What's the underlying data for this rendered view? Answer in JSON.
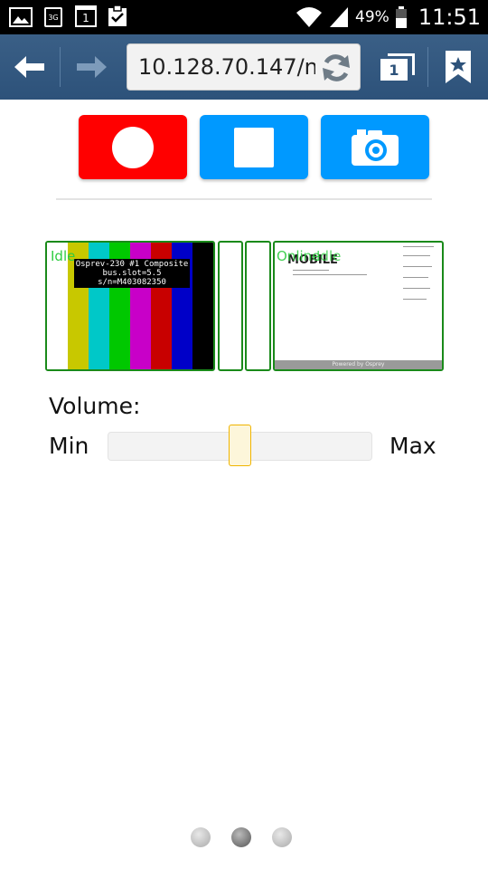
{
  "status_bar": {
    "battery_text": "49%",
    "time": "11:51",
    "icons": [
      "gallery-icon",
      "3g-icon",
      "calendar-icon",
      "clipboard-check-icon",
      "wifi-icon",
      "signal-icon",
      "battery-icon"
    ],
    "calendar_day": "1",
    "net_badge": "3G"
  },
  "browser": {
    "url": "10.128.70.147/n",
    "tab_count": "1",
    "icons": [
      "back-arrow-icon",
      "forward-arrow-icon",
      "reload-icon",
      "tabs-icon",
      "bookmark-icon"
    ]
  },
  "controls": {
    "buttons": [
      {
        "name": "record-button",
        "icon": "record-circle-icon",
        "color": "#ff0000"
      },
      {
        "name": "stop-button",
        "icon": "stop-square-icon",
        "color": "#0099ff"
      },
      {
        "name": "snapshot-button",
        "icon": "camera-icon",
        "color": "#0099ff"
      }
    ]
  },
  "thumbnails": {
    "border_color": "#1a8a1a",
    "status_color": "#2ecc40",
    "source1": {
      "status": "Idle",
      "overlay_lines": [
        "Osprev-230 #1  Composite",
        "bus.slot=5.5",
        "s/n=M403082350"
      ],
      "color_bars": [
        "#ffffff",
        "#c8c800",
        "#00c8c8",
        "#00c800",
        "#c800c8",
        "#c80000",
        "#0000c8",
        "#000000"
      ]
    },
    "source4": {
      "status": "Online",
      "overlay_status": "Idle",
      "doc_title": "MOBILE",
      "footer": "Powered by Osprey"
    }
  },
  "volume": {
    "label": "Volume:",
    "min_label": "Min",
    "max_label": "Max",
    "level": 0.5,
    "handle_color": "#f0b400"
  },
  "pager": {
    "count": 3,
    "active_index": 1
  }
}
